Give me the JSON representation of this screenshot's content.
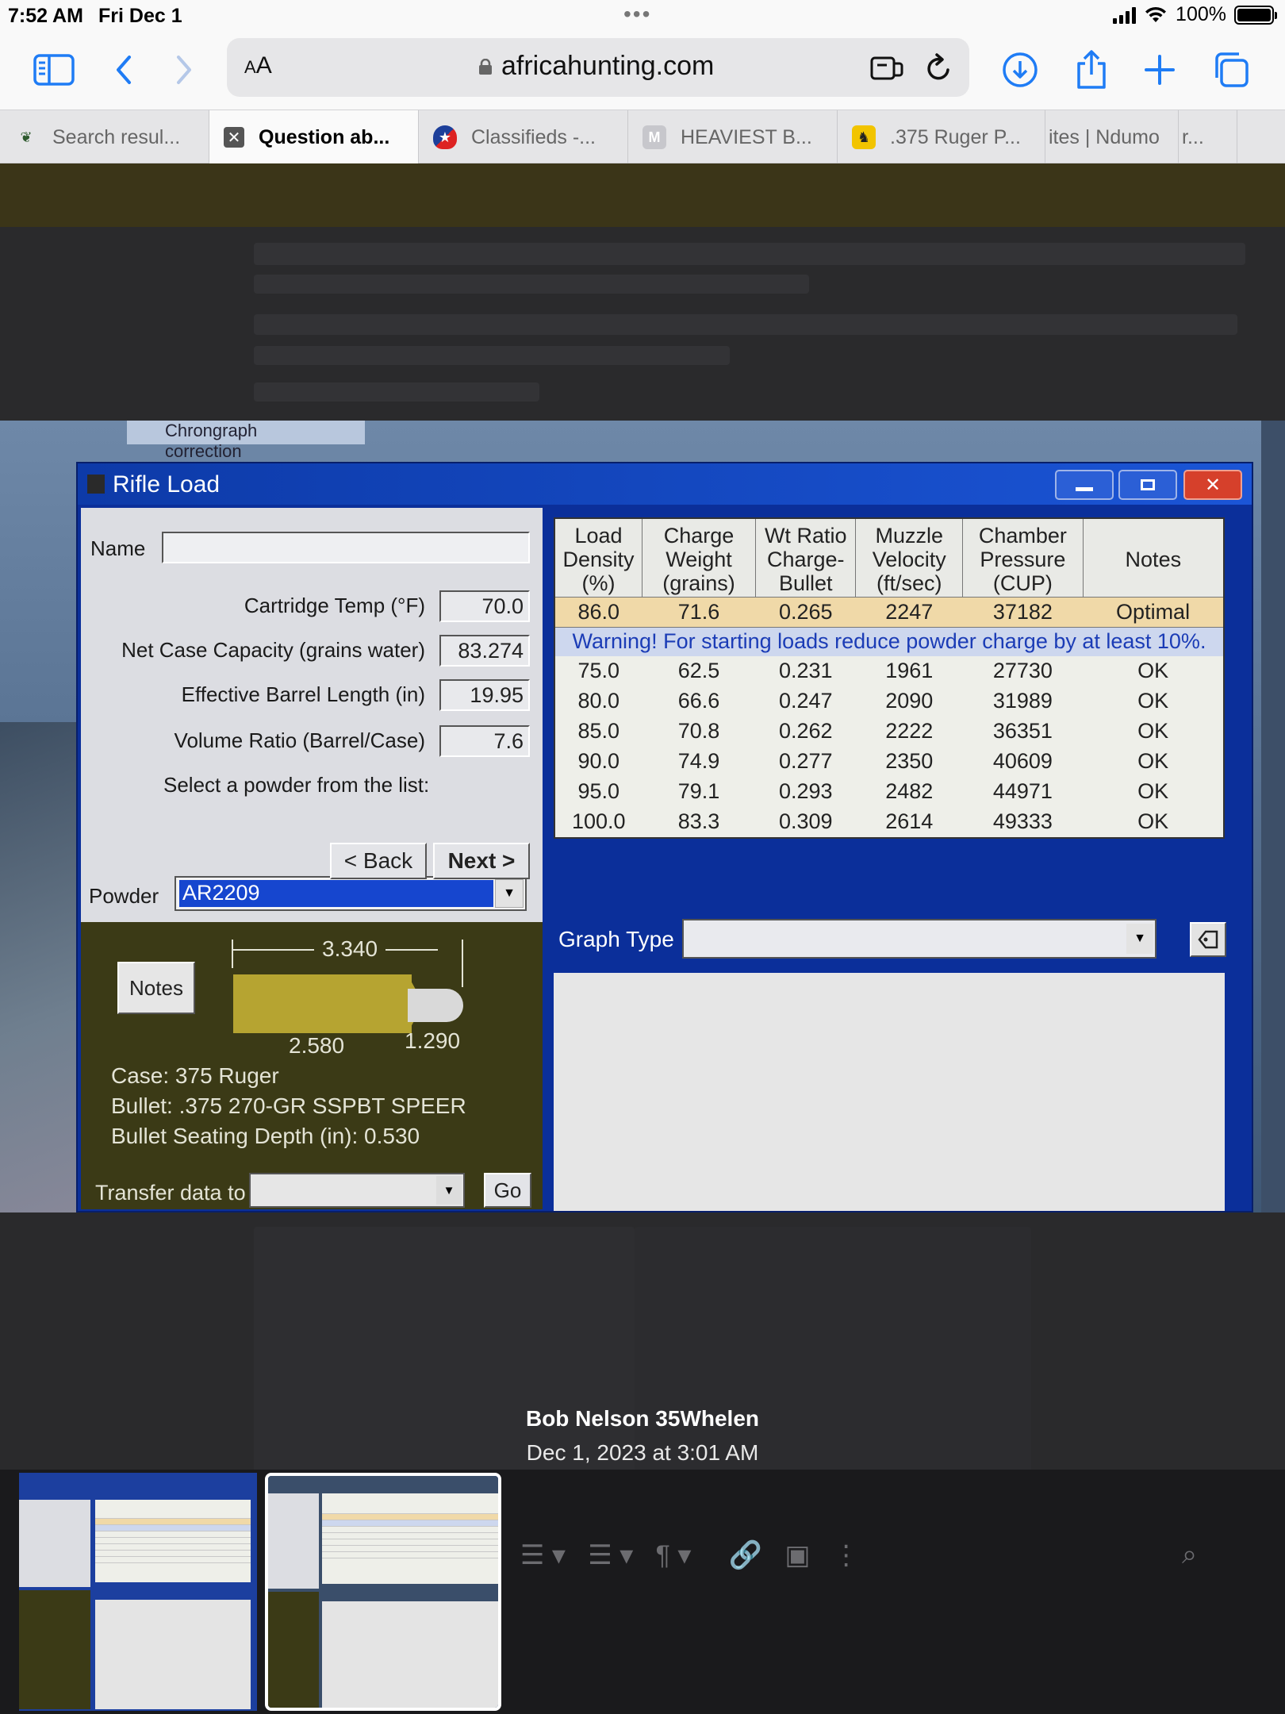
{
  "status_bar": {
    "time": "7:52 AM",
    "date": "Fri Dec 1",
    "battery": "100%"
  },
  "browser": {
    "text_size_label": "AA",
    "url": "africahunting.com",
    "tabs": [
      {
        "label": "Search resul...",
        "active": false
      },
      {
        "label": "Question ab...",
        "active": true
      },
      {
        "label": "Classifieds -...",
        "active": false
      },
      {
        "label": "HEAVIEST B...",
        "active": false
      },
      {
        "label": ".375 Ruger P...",
        "active": false
      },
      {
        "label": "ites | Ndumo",
        "active": false
      },
      {
        "label": "r...",
        "active": false
      }
    ]
  },
  "photo": {
    "background_window_label": "Chrongraph correction",
    "window": {
      "title": "Rifle Load",
      "name_label": "Name",
      "name_value": "",
      "fields": [
        {
          "label": "Cartridge Temp (°F)",
          "value": "70.0"
        },
        {
          "label": "Net Case Capacity (grains water)",
          "value": "83.274"
        },
        {
          "label": "Effective Barrel Length (in)",
          "value": "19.95"
        },
        {
          "label": "Volume Ratio (Barrel/Case)",
          "value": "7.6"
        }
      ],
      "powder_prompt": "Select a powder from the list:",
      "powder_label": "Powder",
      "powder_value": "AR2209",
      "back_label": "< Back",
      "next_label": "Next >",
      "notes_label": "Notes",
      "dims": {
        "overall": "3.340",
        "case": "2.580",
        "bullet": "1.290"
      },
      "case_text": "Case: 375 Ruger",
      "bullet_text": "Bullet: .375 270-GR SSPBT SPEER",
      "seating_text": "Bullet Seating Depth (in): 0.530",
      "transfer_label": "Transfer data to",
      "go_label": "Go",
      "table": {
        "headers": [
          [
            "Load",
            "Density",
            "(%)"
          ],
          [
            "Charge",
            "Weight",
            "(grains)"
          ],
          [
            "Wt Ratio",
            "Charge-",
            "Bullet"
          ],
          [
            "Muzzle",
            "Velocity",
            "(ft/sec)"
          ],
          [
            "Chamber",
            "Pressure",
            "(CUP)"
          ],
          [
            "Notes"
          ]
        ],
        "optimal_row": [
          "86.0",
          "71.6",
          "0.265",
          "2247",
          "37182",
          "Optimal"
        ],
        "warning": "Warning! For starting loads reduce powder charge by at least 10%.",
        "rows": [
          [
            "75.0",
            "62.5",
            "0.231",
            "1961",
            "27730",
            "OK"
          ],
          [
            "80.0",
            "66.6",
            "0.247",
            "2090",
            "31989",
            "OK"
          ],
          [
            "85.0",
            "70.8",
            "0.262",
            "2222",
            "36351",
            "OK"
          ],
          [
            "90.0",
            "74.9",
            "0.277",
            "2350",
            "40609",
            "OK"
          ],
          [
            "95.0",
            "79.1",
            "0.293",
            "2482",
            "44971",
            "OK"
          ],
          [
            "100.0",
            "83.3",
            "0.309",
            "2614",
            "49333",
            "OK"
          ]
        ]
      },
      "graph_type_label": "Graph Type",
      "graph_type_value": ""
    }
  },
  "caption": {
    "author": "Bob Nelson 35Whelen",
    "timestamp": "Dec 1, 2023 at 3:01 AM"
  },
  "colors": {
    "accent": "#1f7cf5",
    "window_blue": "#0b2f9a",
    "optimal_row": "#f0d9a8",
    "warning_text": "#1b3cb6"
  }
}
